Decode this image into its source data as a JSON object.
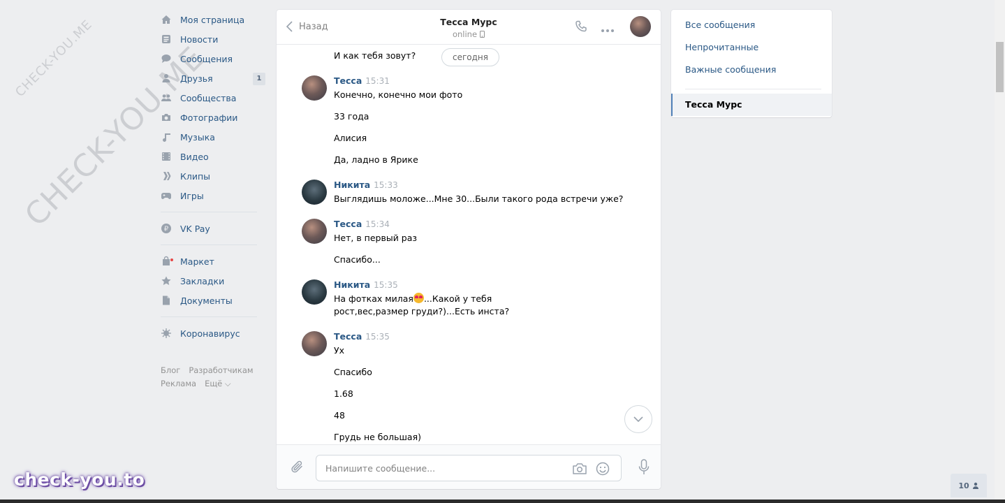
{
  "watermark": {
    "small": "CHECK-YOU.ME",
    "large": "CHECK-YOU.ME"
  },
  "nav": {
    "items": [
      {
        "label": "Моя страница",
        "icon": "home-icon"
      },
      {
        "label": "Новости",
        "icon": "news-icon"
      },
      {
        "label": "Сообщения",
        "icon": "messages-icon"
      },
      {
        "label": "Друзья",
        "icon": "friends-icon",
        "count": "1"
      },
      {
        "label": "Сообщества",
        "icon": "groups-icon"
      },
      {
        "label": "Фотографии",
        "icon": "camera-icon"
      },
      {
        "label": "Музыка",
        "icon": "music-icon"
      },
      {
        "label": "Видео",
        "icon": "video-icon"
      },
      {
        "label": "Клипы",
        "icon": "clips-icon"
      },
      {
        "label": "Игры",
        "icon": "gamepad-icon"
      }
    ],
    "pay": {
      "label": "VK Pay",
      "icon": "ruble-icon"
    },
    "items2": [
      {
        "label": "Маркет",
        "icon": "bag-icon"
      },
      {
        "label": "Закладки",
        "icon": "star-icon"
      },
      {
        "label": "Документы",
        "icon": "document-icon"
      }
    ],
    "corona": {
      "label": "Коронавирус",
      "icon": "virus-icon"
    },
    "footer": {
      "blog": "Блог",
      "developers": "Разработчикам",
      "ads": "Реклама",
      "more": "Ещё ⌵"
    }
  },
  "chat": {
    "back_label": "Назад",
    "peer_name": "Тесса Мурс",
    "peer_status": "online",
    "date_pill": "сегодня",
    "top_line": "И как тебя зовут?",
    "messages": [
      {
        "author": "Тесса",
        "time": "15:31",
        "lines": [
          "Конечно, конечно мои фото",
          "33 года",
          "Алисия",
          "Да, ладно в Ярике"
        ]
      },
      {
        "author": "Никита",
        "time": "15:33",
        "lines": [
          "Выглядишь моложе...Мне 30...Были такого рода встречи уже?"
        ]
      },
      {
        "author": "Тесса",
        "time": "15:34",
        "lines": [
          "Нет, в первый раз",
          "Спасибо..."
        ]
      },
      {
        "author": "Никита",
        "time": "15:35",
        "text_before_emoji": "На фотках милая",
        "text_after_emoji": "...Какой у тебя рост,вес,размер груди?)...Есть инста?"
      },
      {
        "author": "Тесса",
        "time": "15:35",
        "lines": [
          "Ух",
          "Спасибо",
          "1.68",
          "48",
          "Грудь не большая)"
        ]
      }
    ],
    "input_placeholder": "Напишите сообщение..."
  },
  "right_panel": {
    "all": "Все сообщения",
    "unread": "Непрочитанные",
    "important": "Важные сообщения",
    "active_chat": "Тесса Мурс"
  },
  "brand_logo": "check-you.to",
  "online_widget": {
    "count": "10"
  },
  "colors": {
    "link": "#2a5885",
    "accent": "#5181b8",
    "background": "#edeef0"
  }
}
